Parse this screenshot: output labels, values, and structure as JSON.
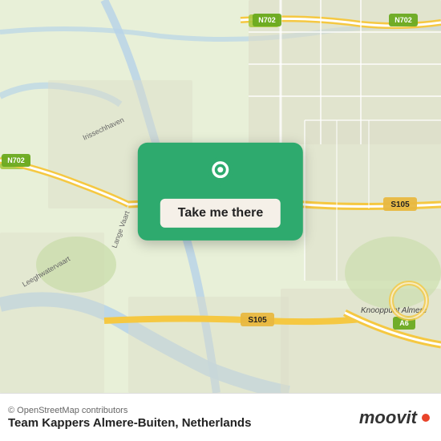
{
  "map": {
    "alt": "Map of Almere-Buiten, Netherlands"
  },
  "button": {
    "label": "Take me there"
  },
  "bottom": {
    "copyright": "© OpenStreetMap contributors",
    "location": "Team Kappers Almere-Buiten, Netherlands",
    "logo_text": "moovit"
  },
  "colors": {
    "green": "#2eaa6e",
    "red": "#e8442a",
    "road_main": "#f5c842",
    "road_secondary": "#ffffff",
    "water": "#b8d4e8",
    "land": "#e8f0d8",
    "urban": "#dcdcc8"
  }
}
